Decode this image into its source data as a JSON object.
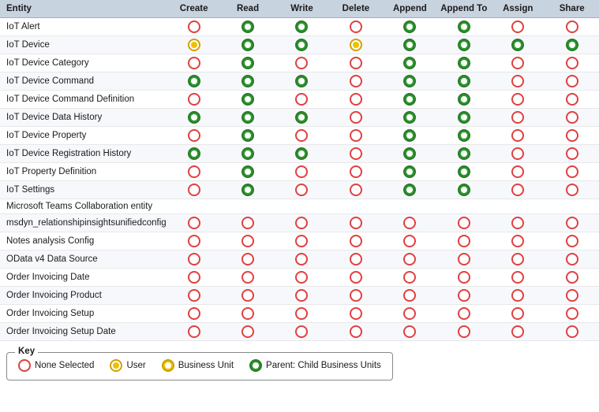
{
  "header": {
    "columns": [
      "Entity",
      "Create",
      "Read",
      "Write",
      "Delete",
      "Append",
      "Append To",
      "Assign",
      "Share"
    ]
  },
  "rows": [
    {
      "name": "IoT Alert",
      "perms": [
        "none",
        "parent",
        "parent",
        "none",
        "parent",
        "parent",
        "none",
        "none"
      ]
    },
    {
      "name": "IoT Device",
      "perms": [
        "user",
        "parent",
        "parent",
        "user",
        "parent",
        "parent",
        "parent",
        "parent"
      ]
    },
    {
      "name": "IoT Device Category",
      "perms": [
        "none",
        "parent",
        "none",
        "none",
        "parent",
        "parent",
        "none",
        "none"
      ]
    },
    {
      "name": "IoT Device Command",
      "perms": [
        "parent",
        "parent",
        "parent",
        "none",
        "parent",
        "parent",
        "none",
        "none"
      ]
    },
    {
      "name": "IoT Device Command Definition",
      "perms": [
        "none",
        "parent",
        "none",
        "none",
        "parent",
        "parent",
        "none",
        "none"
      ]
    },
    {
      "name": "IoT Device Data History",
      "perms": [
        "parent",
        "parent",
        "parent",
        "none",
        "parent",
        "parent",
        "none",
        "none"
      ]
    },
    {
      "name": "IoT Device Property",
      "perms": [
        "none",
        "parent",
        "none",
        "none",
        "parent",
        "parent",
        "none",
        "none"
      ]
    },
    {
      "name": "IoT Device Registration History",
      "perms": [
        "parent",
        "parent",
        "parent",
        "none",
        "parent",
        "parent",
        "none",
        "none"
      ]
    },
    {
      "name": "IoT Property Definition",
      "perms": [
        "none",
        "parent",
        "none",
        "none",
        "parent",
        "parent",
        "none",
        "none"
      ]
    },
    {
      "name": "IoT Settings",
      "perms": [
        "none",
        "parent",
        "none",
        "none",
        "parent",
        "parent",
        "none",
        "none"
      ]
    },
    {
      "name": "Microsoft Teams Collaboration entity",
      "perms": [
        "",
        "",
        "",
        "",
        "",
        "",
        "",
        ""
      ]
    },
    {
      "name": "msdyn_relationshipinsightsunifiedconfig",
      "perms": [
        "none",
        "none",
        "none",
        "none",
        "none",
        "none",
        "none",
        "none"
      ]
    },
    {
      "name": "Notes analysis Config",
      "perms": [
        "none",
        "none",
        "none",
        "none",
        "none",
        "none",
        "none",
        "none"
      ]
    },
    {
      "name": "OData v4 Data Source",
      "perms": [
        "none",
        "none",
        "none",
        "none",
        "none",
        "none",
        "none",
        "none"
      ]
    },
    {
      "name": "Order Invoicing Date",
      "perms": [
        "none",
        "none",
        "none",
        "none",
        "none",
        "none",
        "none",
        "none"
      ]
    },
    {
      "name": "Order Invoicing Product",
      "perms": [
        "none",
        "none",
        "none",
        "none",
        "none",
        "none",
        "none",
        "none"
      ]
    },
    {
      "name": "Order Invoicing Setup",
      "perms": [
        "none",
        "none",
        "none",
        "none",
        "none",
        "none",
        "none",
        "none"
      ]
    },
    {
      "name": "Order Invoicing Setup Date",
      "perms": [
        "none",
        "none",
        "none",
        "none",
        "none",
        "none",
        "none",
        "none"
      ]
    }
  ],
  "key": {
    "title": "Key",
    "items": [
      {
        "type": "none",
        "label": "None Selected"
      },
      {
        "type": "user",
        "label": "User"
      },
      {
        "type": "business",
        "label": "Business Unit"
      },
      {
        "type": "parent",
        "label": "Parent: Child Business Units"
      }
    ]
  }
}
